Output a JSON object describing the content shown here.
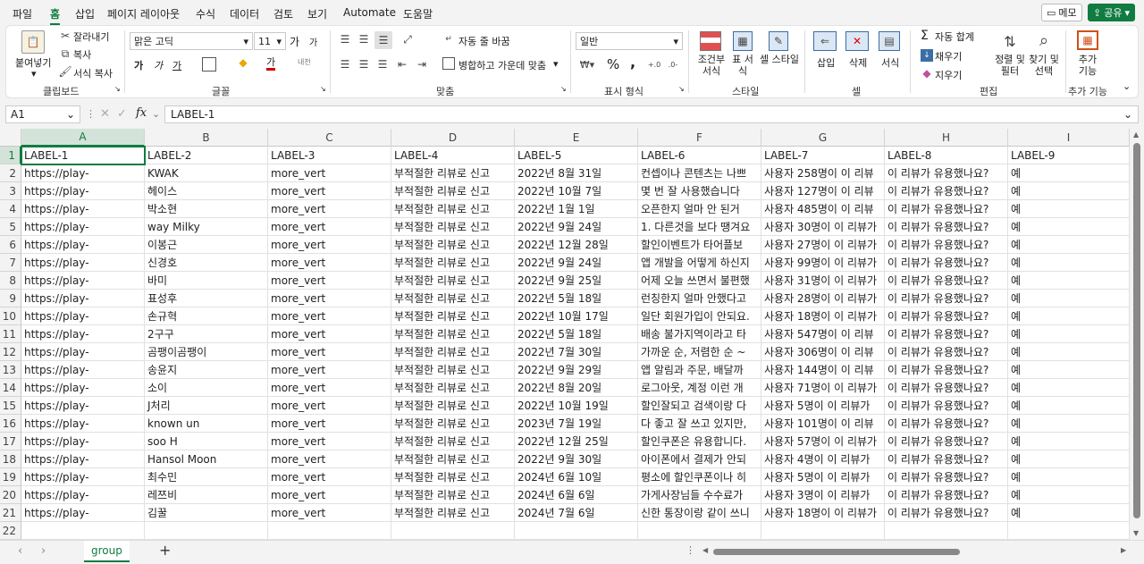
{
  "menu": {
    "items": [
      "파일",
      "홈",
      "삽입",
      "페이지 레이아웃",
      "수식",
      "데이터",
      "검토",
      "보기",
      "Automate",
      "도움말"
    ],
    "active": "홈",
    "memo": "메모",
    "share": "공유"
  },
  "ribbon": {
    "clipboard": {
      "paste": "붙여넣기",
      "cut": "잘라내기",
      "copy": "복사",
      "format_painter": "서식 복사",
      "label": "클립보드"
    },
    "font": {
      "name": "맑은 고딕",
      "size": "11",
      "label": "글꼴",
      "grow": "가",
      "shrink": "가",
      "bold": "가",
      "italic": "가",
      "underline": "가",
      "font_color": "가",
      "phonetic": "내천"
    },
    "alignment": {
      "wrap": "자동 줄 바꿈",
      "merge": "병합하고 가운데 맞춤",
      "label": "맞춤"
    },
    "number": {
      "format": "일반",
      "label": "표시 형식",
      "percent": "%",
      "comma": ","
    },
    "styles": {
      "conditional": "조건부 서식",
      "table": "표 서식",
      "cell_style": "셀 스타일",
      "label": "스타일"
    },
    "cells": {
      "insert": "삽입",
      "delete": "삭제",
      "format": "서식",
      "label": "셀"
    },
    "editing": {
      "autosum": "자동 합계",
      "fill": "채우기",
      "clear": "지우기",
      "sort": "정렬 및 필터",
      "find": "찾기 및 선택",
      "label": "편집"
    },
    "addins": {
      "label_btn": "추가 기능",
      "label": "추가 기능"
    }
  },
  "formula": {
    "name_box": "A1",
    "fx": "fx",
    "value": "LABEL-1"
  },
  "columns": [
    "A",
    "B",
    "C",
    "D",
    "E",
    "F",
    "G",
    "H",
    "I"
  ],
  "selected_column": "A",
  "header_row": [
    "LABEL-1",
    "LABEL-2",
    "LABEL-3",
    "LABEL-4",
    "LABEL-5",
    "LABEL-6",
    "LABEL-7",
    "LABEL-8",
    "LABEL-9"
  ],
  "rows": [
    [
      "https://play-",
      "KWAK",
      "more_vert",
      "부적절한 리뷰로 신고",
      "2022년 8월 31일",
      "컨셉이나 콘텐츠는 나쁘",
      "사용자 258명이 이 리뷰",
      "이 리뷰가 유용했나요?",
      "예"
    ],
    [
      "https://play-",
      "헤이스",
      "more_vert",
      "부적절한 리뷰로 신고",
      "2022년 10월 7일",
      "몇 번 잘 사용했습니다",
      "사용자 127명이 이 리뷰",
      "이 리뷰가 유용했나요?",
      "예"
    ],
    [
      "https://play-",
      "박소현",
      "more_vert",
      "부적절한 리뷰로 신고",
      "2022년 1월 1일",
      "오픈한지 얼마 안 된거",
      "사용자 485명이 이 리뷰",
      "이 리뷰가 유용했나요?",
      "예"
    ],
    [
      "https://play-",
      "way Milky",
      "more_vert",
      "부적절한 리뷰로 신고",
      "2022년 9월 24일",
      "1. 다른것을 보다 땡겨요",
      "사용자 30명이 이 리뷰가",
      "이 리뷰가 유용했나요?",
      "예"
    ],
    [
      "https://play-",
      "이봉근",
      "more_vert",
      "부적절한 리뷰로 신고",
      "2022년 12월 28일",
      "할인이벤트가 타어플보",
      "사용자 27명이 이 리뷰가",
      "이 리뷰가 유용했나요?",
      "예"
    ],
    [
      "https://play-",
      "신경호",
      "more_vert",
      "부적절한 리뷰로 신고",
      "2022년 9월 24일",
      "앱 개발을 어떻게 하신지",
      "사용자 99명이 이 리뷰가",
      "이 리뷰가 유용했나요?",
      "예"
    ],
    [
      "https://play-",
      "바미",
      "more_vert",
      "부적절한 리뷰로 신고",
      "2022년 9월 25일",
      "어제 오늘 쓰면서 불편했",
      "사용자 31명이 이 리뷰가",
      "이 리뷰가 유용했나요?",
      "예"
    ],
    [
      "https://play-",
      "표성후",
      "more_vert",
      "부적절한 리뷰로 신고",
      "2022년 5월 18일",
      "런칭한지 얼마 안했다고",
      "사용자 28명이 이 리뷰가",
      "이 리뷰가 유용했나요?",
      "예"
    ],
    [
      "https://play-",
      "손규혁",
      "more_vert",
      "부적절한 리뷰로 신고",
      "2022년 10월 17일",
      "일단 회원가입이 안되요.",
      "사용자 18명이 이 리뷰가",
      "이 리뷰가 유용했나요?",
      "예"
    ],
    [
      "https://play-",
      "2구구",
      "more_vert",
      "부적절한 리뷰로 신고",
      "2022년 5월 18일",
      "배송 불가지역이라고 타",
      "사용자 547명이 이 리뷰",
      "이 리뷰가 유용했나요?",
      "예"
    ],
    [
      "https://play-",
      "곰팽이곰팽이",
      "more_vert",
      "부적절한 리뷰로 신고",
      "2022년 7월 30일",
      "가까운 순, 저렴한 순 ~",
      "사용자 306명이 이 리뷰",
      "이 리뷰가 유용했나요?",
      "예"
    ],
    [
      "https://play-",
      "송윤지",
      "more_vert",
      "부적절한 리뷰로 신고",
      "2022년 9월 29일",
      "앱 알림과 주문, 배달까",
      "사용자 144명이 이 리뷰",
      "이 리뷰가 유용했나요?",
      "예"
    ],
    [
      "https://play-",
      "소이",
      "more_vert",
      "부적절한 리뷰로 신고",
      "2022년 8월 20일",
      "로그아웃, 계정 이런 개",
      "사용자 71명이 이 리뷰가",
      "이 리뷰가 유용했나요?",
      "예"
    ],
    [
      "https://play-",
      "J처리",
      "more_vert",
      "부적절한 리뷰로 신고",
      "2022년 10월 19일",
      "할인잘되고 검색이랑 다",
      "사용자 5명이 이 리뷰가",
      "이 리뷰가 유용했나요?",
      "예"
    ],
    [
      "https://play-",
      "known un",
      "more_vert",
      "부적절한 리뷰로 신고",
      "2023년 7월 19일",
      "다 좋고 잘 쓰고 있지만,",
      "사용자 101명이 이 리뷰",
      "이 리뷰가 유용했나요?",
      "예"
    ],
    [
      "https://play-",
      "soo H",
      "more_vert",
      "부적절한 리뷰로 신고",
      "2022년 12월 25일",
      "할인쿠폰은 유용합니다.",
      "사용자 57명이 이 리뷰가",
      "이 리뷰가 유용했나요?",
      "예"
    ],
    [
      "https://play-",
      "Hansol Moon",
      "more_vert",
      "부적절한 리뷰로 신고",
      "2022년 9월 30일",
      "아이폰에서 결제가 안되",
      "사용자 4명이 이 리뷰가",
      "이 리뷰가 유용했나요?",
      "예"
    ],
    [
      "https://play-",
      "최수민",
      "more_vert",
      "부적절한 리뷰로 신고",
      "2024년 6월 10일",
      "평소에 할인쿠폰이나 히",
      "사용자 5명이 이 리뷰가",
      "이 리뷰가 유용했나요?",
      "예"
    ],
    [
      "https://play-",
      "레쯔비",
      "more_vert",
      "부적절한 리뷰로 신고",
      "2024년 6월 6일",
      "가게사장님들 수수료가",
      "사용자 3명이 이 리뷰가",
      "이 리뷰가 유용했나요?",
      "예"
    ],
    [
      "https://play-",
      "김꿀",
      "more_vert",
      "부적절한 리뷰로 신고",
      "2024년 7월 6일",
      "신한 통장이랑 같이 쓰니",
      "사용자 18명이 이 리뷰가",
      "이 리뷰가 유용했나요?",
      "예"
    ]
  ],
  "row_numbers": [
    "1",
    "2",
    "3",
    "4",
    "5",
    "6",
    "7",
    "8",
    "9",
    "10",
    "11",
    "12",
    "13",
    "14",
    "15",
    "16",
    "17",
    "18",
    "19",
    "20",
    "21",
    "22"
  ],
  "status": {
    "sheet_name": "group",
    "add_sheet": "+"
  }
}
